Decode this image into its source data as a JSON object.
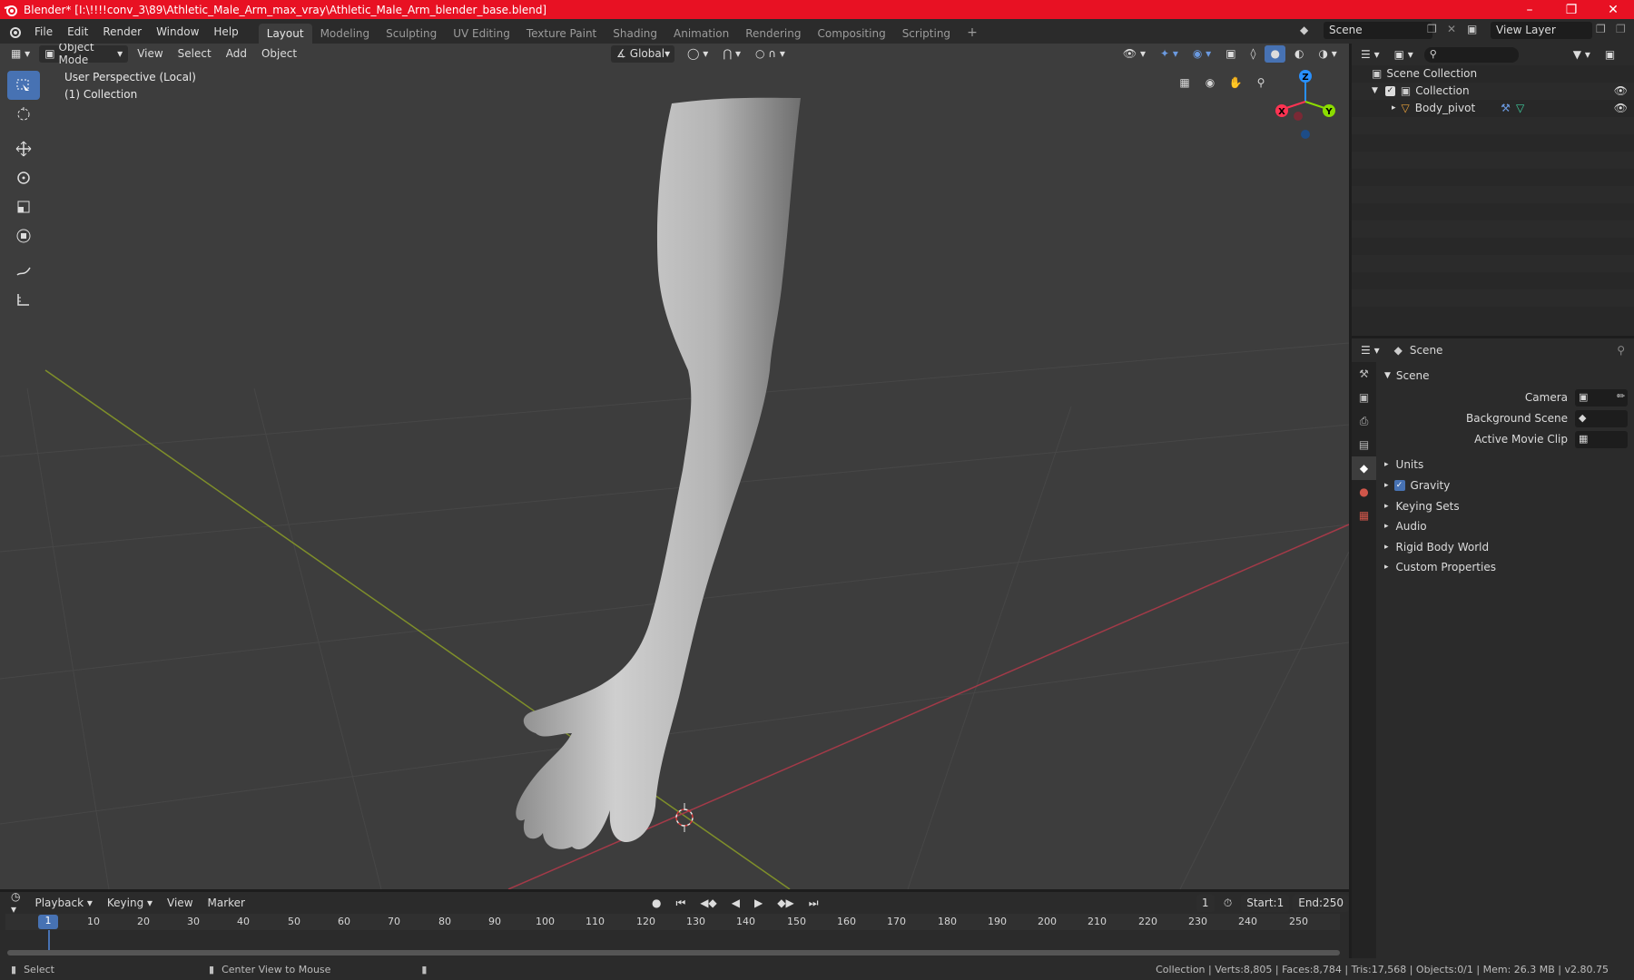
{
  "window": {
    "title": "Blender* [I:\\!!!!conv_3\\89\\Athletic_Male_Arm_max_vray\\Athletic_Male_Arm_blender_base.blend]"
  },
  "menu": [
    "File",
    "Edit",
    "Render",
    "Window",
    "Help"
  ],
  "workspaces": [
    "Layout",
    "Modeling",
    "Sculpting",
    "UV Editing",
    "Texture Paint",
    "Shading",
    "Animation",
    "Rendering",
    "Compositing",
    "Scripting"
  ],
  "scene_selector": "Scene",
  "view_layer_selector": "View Layer",
  "viewport_header": {
    "mode": "Object Mode",
    "menus": [
      "View",
      "Select",
      "Add",
      "Object"
    ],
    "orientation": "Global"
  },
  "viewport_overlay": {
    "perspective": "User Perspective (Local)",
    "collection": "(1) Collection"
  },
  "gizmo": {
    "z": "Z",
    "x": "X",
    "y": "Y"
  },
  "outliner": {
    "root": "Scene Collection",
    "collection": "Collection",
    "object": "Body_pivot"
  },
  "properties": {
    "header": "Scene",
    "panel": "Scene",
    "camera_label": "Camera",
    "background_scene_label": "Background Scene",
    "active_movie_clip_label": "Active Movie Clip",
    "sections": [
      "Units",
      "Gravity",
      "Keying Sets",
      "Audio",
      "Rigid Body World",
      "Custom Properties"
    ]
  },
  "timeline": {
    "menus": [
      "Playback",
      "Keying",
      "View",
      "Marker"
    ],
    "current_frame": "1",
    "start_label": "Start:",
    "start": "1",
    "end_label": "End:",
    "end": "250",
    "ruler": [
      "1",
      "10",
      "20",
      "30",
      "40",
      "50",
      "60",
      "70",
      "80",
      "90",
      "100",
      "110",
      "120",
      "130",
      "140",
      "150",
      "160",
      "170",
      "180",
      "190",
      "200",
      "210",
      "220",
      "230",
      "240",
      "250"
    ]
  },
  "status": {
    "left": "Select",
    "middle": "Center View to Mouse",
    "right": "Collection | Verts:8,805 | Faces:8,784 | Tris:17,568 | Objects:0/1 | Mem: 26.3 MB | v2.80.75"
  },
  "colors": {
    "title_bar": "#e81123",
    "active_tool": "#4772b3",
    "axis_x": "#ff3352",
    "axis_y": "#8bdc00",
    "axis_z": "#2890ff"
  }
}
